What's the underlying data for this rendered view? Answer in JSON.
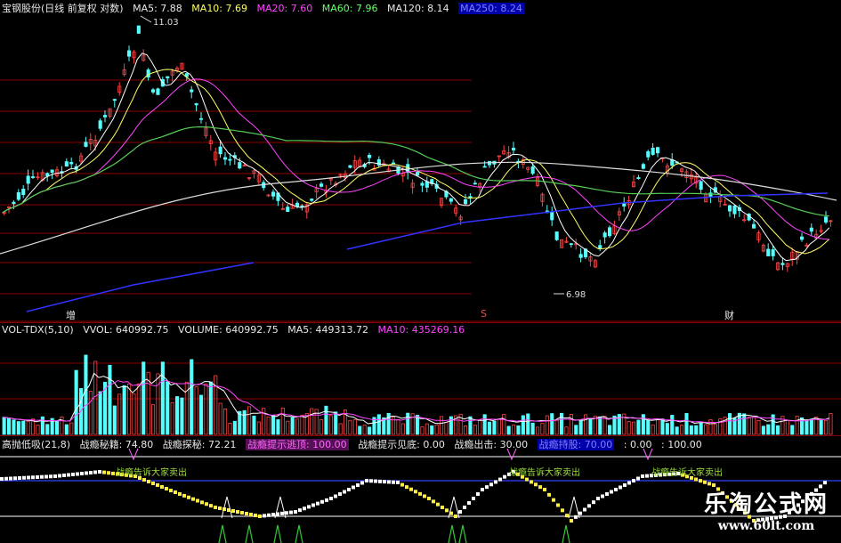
{
  "main": {
    "title": "宝钢股份(日线 前复权 对数)",
    "ma": [
      {
        "label": "MA5: 7.88",
        "cls": "c-white"
      },
      {
        "label": "MA10: 7.69",
        "cls": "c-yellow"
      },
      {
        "label": "MA20: 7.60",
        "cls": "c-magenta"
      },
      {
        "label": "MA60: 7.96",
        "cls": "c-green"
      },
      {
        "label": "MA120: 8.14",
        "cls": "c-white"
      },
      {
        "label": "MA250: 8.24",
        "cls": "c-blue-box"
      }
    ],
    "high_label": "11.03",
    "low_label": "6.98",
    "markers": [
      "增",
      "S",
      "财"
    ]
  },
  "volume": {
    "name": "VOL-TDX(5,10)",
    "items": [
      {
        "label": "VVOL: 640992.75",
        "cls": "c-white"
      },
      {
        "label": "VOLUME: 640992.75",
        "cls": "c-white"
      },
      {
        "label": "MA5: 449313.72",
        "cls": "c-white"
      },
      {
        "label": "MA10: 435269.16",
        "cls": "c-magenta"
      }
    ]
  },
  "indicator": {
    "name": "高抛低吸(21,8)",
    "items": [
      {
        "label": "战瘾秘籍: 74.80",
        "cls": "c-white"
      },
      {
        "label": "战瘾探秘: 72.21",
        "cls": "c-white"
      },
      {
        "label": "战瘾提示逃顶: 100.00",
        "cls": "c-pink-box"
      },
      {
        "label": "战瘾提示见底: 0.00",
        "cls": "c-white"
      },
      {
        "label": "战瘾出击: 30.00",
        "cls": "c-white"
      },
      {
        "label": "战瘾持股: 70.00",
        "cls": "c-blue-box"
      },
      {
        "label": ": 0.00",
        "cls": "c-white"
      },
      {
        "label": ": 100.00",
        "cls": "c-white"
      }
    ],
    "signals": [
      "战瘾告诉大家卖出",
      "战瘾告诉大家卖出",
      "战瘾告诉大家卖出"
    ]
  },
  "watermark": {
    "title": "乐淘公式网",
    "url": "www.60lt.com"
  },
  "colors": {
    "up": "#ff4444",
    "down": "#55ffff",
    "grid": "#8b0000"
  }
}
